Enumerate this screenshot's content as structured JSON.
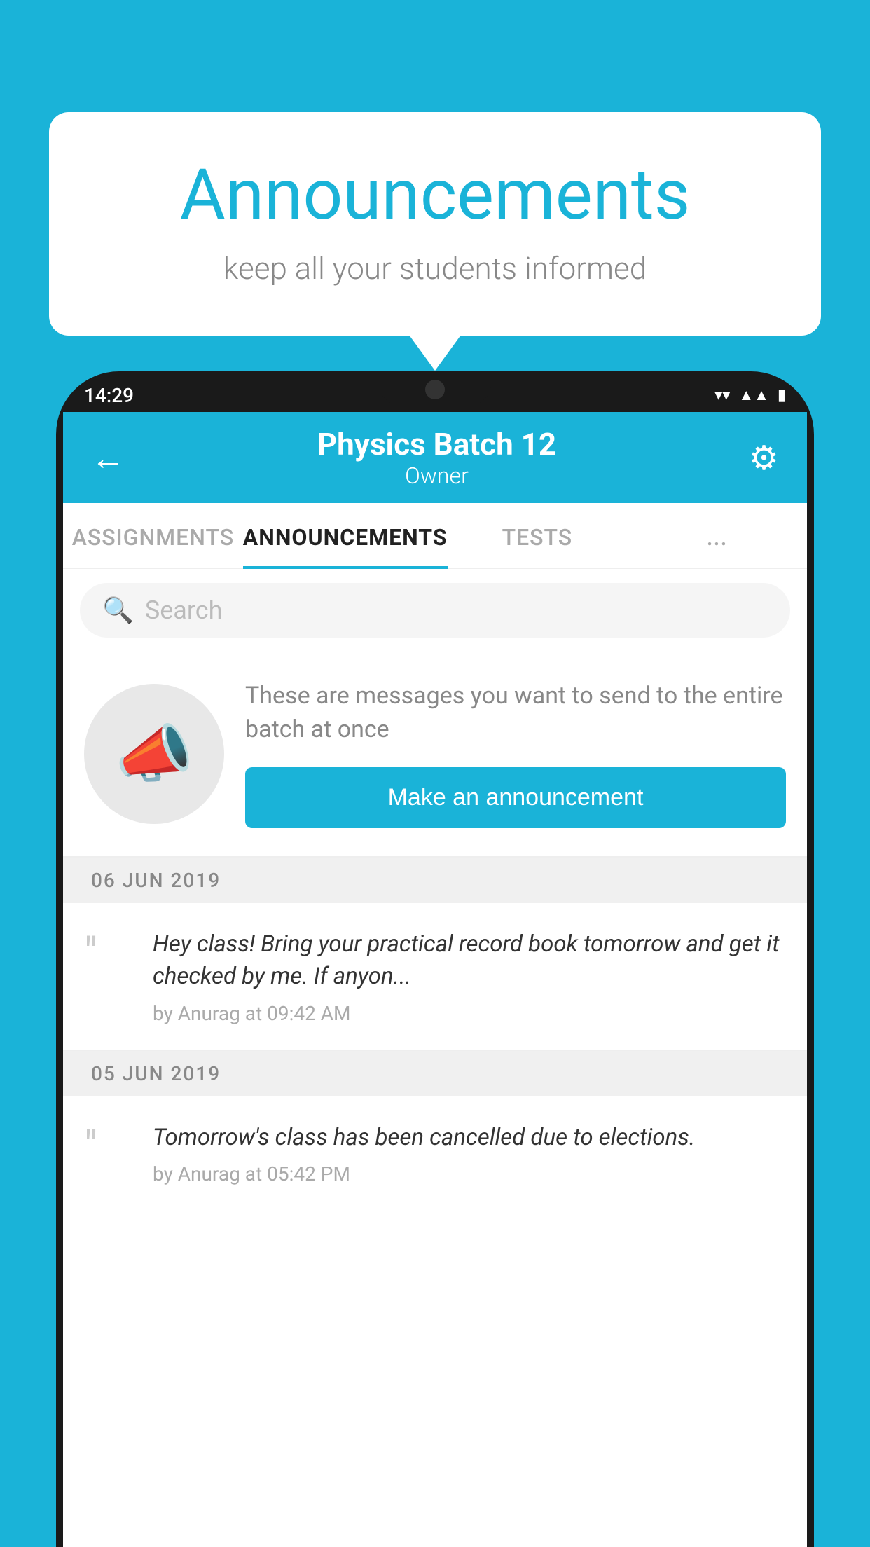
{
  "bubble": {
    "title": "Announcements",
    "subtitle": "keep all your students informed"
  },
  "phone": {
    "status": {
      "time": "14:29",
      "icons": [
        "wifi",
        "signal",
        "battery"
      ]
    },
    "header": {
      "title": "Physics Batch 12",
      "subtitle": "Owner",
      "back_label": "←",
      "gear_label": "⚙"
    },
    "tabs": [
      {
        "label": "ASSIGNMENTS",
        "active": false
      },
      {
        "label": "ANNOUNCEMENTS",
        "active": true
      },
      {
        "label": "TESTS",
        "active": false
      },
      {
        "label": "...",
        "active": false
      }
    ],
    "search": {
      "placeholder": "Search"
    },
    "promo": {
      "description": "These are messages you want to send to the entire batch at once",
      "button_label": "Make an announcement"
    },
    "announcements": [
      {
        "date": "06  JUN  2019",
        "message": "Hey class! Bring your practical record book tomorrow and get it checked by me. If anyon...",
        "meta": "by Anurag at 09:42 AM"
      },
      {
        "date": "05  JUN  2019",
        "message": "Tomorrow's class has been cancelled due to elections.",
        "meta": "by Anurag at 05:42 PM"
      }
    ]
  },
  "colors": {
    "primary": "#1ab3d8",
    "background": "#1ab3d8",
    "white": "#ffffff",
    "text_dark": "#222222",
    "text_gray": "#888888",
    "text_light": "#bbbbbb"
  }
}
